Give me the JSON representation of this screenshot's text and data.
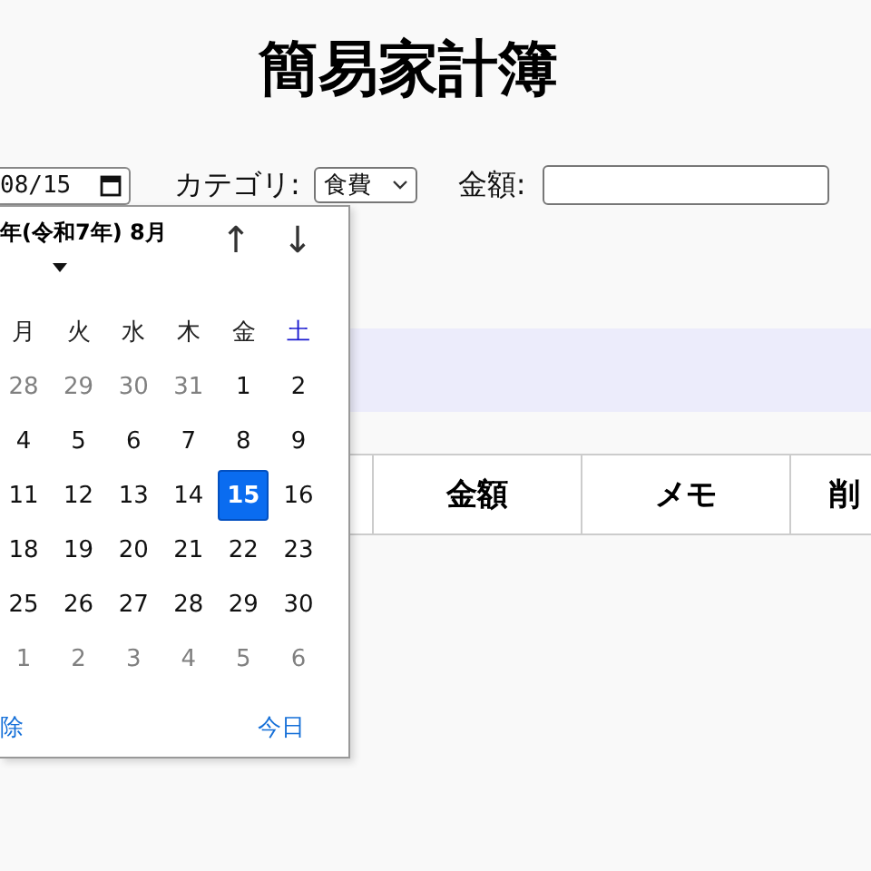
{
  "title": "簡易家計簿",
  "form": {
    "date_value": "08/15",
    "category_label": "カテゴリ:",
    "category_value": "食費",
    "amount_label": "金額:"
  },
  "table": {
    "columns": [
      "金額",
      "メモ",
      "削"
    ]
  },
  "calendar": {
    "month_label": "年(令和7年) 8月",
    "up": "↑",
    "down": "↓",
    "weekdays": [
      {
        "label": "月",
        "color": "#222222"
      },
      {
        "label": "火",
        "color": "#222222"
      },
      {
        "label": "水",
        "color": "#222222"
      },
      {
        "label": "木",
        "color": "#222222"
      },
      {
        "label": "金",
        "color": "#222222"
      },
      {
        "label": "土",
        "color": "#1a1ad0"
      }
    ],
    "days": [
      {
        "label": "28",
        "other_month": true,
        "selected": false
      },
      {
        "label": "29",
        "other_month": true,
        "selected": false
      },
      {
        "label": "30",
        "other_month": true,
        "selected": false
      },
      {
        "label": "31",
        "other_month": true,
        "selected": false
      },
      {
        "label": "1",
        "other_month": false,
        "selected": false
      },
      {
        "label": "2",
        "other_month": false,
        "selected": false
      },
      {
        "label": "4",
        "other_month": false,
        "selected": false
      },
      {
        "label": "5",
        "other_month": false,
        "selected": false
      },
      {
        "label": "6",
        "other_month": false,
        "selected": false
      },
      {
        "label": "7",
        "other_month": false,
        "selected": false
      },
      {
        "label": "8",
        "other_month": false,
        "selected": false
      },
      {
        "label": "9",
        "other_month": false,
        "selected": false
      },
      {
        "label": "11",
        "other_month": false,
        "selected": false
      },
      {
        "label": "12",
        "other_month": false,
        "selected": false
      },
      {
        "label": "13",
        "other_month": false,
        "selected": false
      },
      {
        "label": "14",
        "other_month": false,
        "selected": false
      },
      {
        "label": "15",
        "other_month": false,
        "selected": true
      },
      {
        "label": "16",
        "other_month": false,
        "selected": false
      },
      {
        "label": "18",
        "other_month": false,
        "selected": false
      },
      {
        "label": "19",
        "other_month": false,
        "selected": false
      },
      {
        "label": "20",
        "other_month": false,
        "selected": false
      },
      {
        "label": "21",
        "other_month": false,
        "selected": false
      },
      {
        "label": "22",
        "other_month": false,
        "selected": false
      },
      {
        "label": "23",
        "other_month": false,
        "selected": false
      },
      {
        "label": "25",
        "other_month": false,
        "selected": false
      },
      {
        "label": "26",
        "other_month": false,
        "selected": false
      },
      {
        "label": "27",
        "other_month": false,
        "selected": false
      },
      {
        "label": "28",
        "other_month": false,
        "selected": false
      },
      {
        "label": "29",
        "other_month": false,
        "selected": false
      },
      {
        "label": "30",
        "other_month": false,
        "selected": false
      },
      {
        "label": "1",
        "other_month": true,
        "selected": false
      },
      {
        "label": "2",
        "other_month": true,
        "selected": false
      },
      {
        "label": "3",
        "other_month": true,
        "selected": false
      },
      {
        "label": "4",
        "other_month": true,
        "selected": false
      },
      {
        "label": "5",
        "other_month": true,
        "selected": false
      },
      {
        "label": "6",
        "other_month": true,
        "selected": false
      }
    ],
    "clear": "除",
    "today": "今日"
  }
}
